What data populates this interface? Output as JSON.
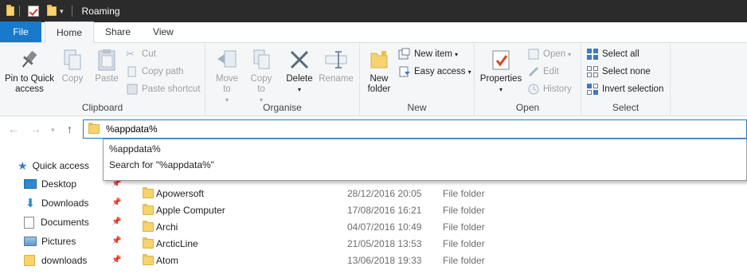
{
  "window": {
    "title": "Roaming"
  },
  "tabs": [
    "File",
    "Home",
    "Share",
    "View"
  ],
  "ribbon": {
    "clipboard": {
      "label": "Clipboard",
      "pin": "Pin to Quick access",
      "copy": "Copy",
      "paste": "Paste",
      "cut": "Cut",
      "copy_path": "Copy path",
      "paste_shortcut": "Paste shortcut"
    },
    "organise": {
      "label": "Organise",
      "move_to": "Move to",
      "copy_to": "Copy to",
      "delete": "Delete",
      "rename": "Rename"
    },
    "new": {
      "label": "New",
      "new_folder": "New folder",
      "new_item": "New item",
      "easy_access": "Easy access"
    },
    "open": {
      "label": "Open",
      "properties": "Properties",
      "open": "Open",
      "edit": "Edit",
      "history": "History"
    },
    "select": {
      "label": "Select",
      "select_all": "Select all",
      "select_none": "Select none",
      "invert": "Invert selection"
    }
  },
  "address": {
    "value": "%appdata%"
  },
  "autocomplete": [
    "%appdata%",
    "Search for \"%appdata%\""
  ],
  "nav": [
    {
      "label": "Quick access",
      "icon": "star-icon"
    },
    {
      "label": "Desktop",
      "icon": "desktop-icon"
    },
    {
      "label": "Downloads",
      "icon": "download-icon"
    },
    {
      "label": "Documents",
      "icon": "documents-icon"
    },
    {
      "label": "Pictures",
      "icon": "pictures-icon"
    },
    {
      "label": "downloads",
      "icon": "folder-icon"
    }
  ],
  "files": [
    {
      "name": "Apowersoft",
      "date": "28/12/2016 20:05",
      "type": "File folder"
    },
    {
      "name": "Apple Computer",
      "date": "17/08/2016 16:21",
      "type": "File folder"
    },
    {
      "name": "Archi",
      "date": "04/07/2016 10:49",
      "type": "File folder"
    },
    {
      "name": "ArcticLine",
      "date": "21/05/2018 13:53",
      "type": "File folder"
    },
    {
      "name": "Atom",
      "date": "13/06/2018 19:33",
      "type": "File folder"
    }
  ],
  "colors": {
    "accent": "#1979ca",
    "titlebar": "#2b2b2b",
    "ribbon": "#f5f6f7"
  }
}
